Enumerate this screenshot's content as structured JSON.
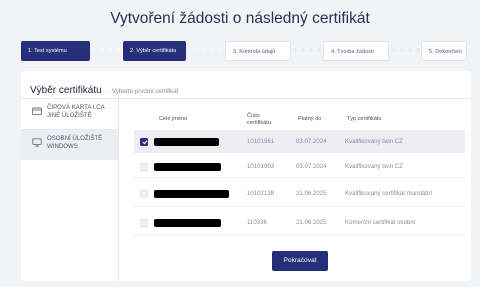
{
  "page": {
    "title": "Vytvoření žádosti o následný certifikát"
  },
  "stepper": {
    "steps": [
      {
        "label": "1. Test systému",
        "state": "done"
      },
      {
        "label": "2. Výběr certifikátu",
        "state": "active"
      },
      {
        "label": "3. Kontrola údajů",
        "state": "pending"
      },
      {
        "label": "4. Tvorba žádosti",
        "state": "pending"
      },
      {
        "label": "5. Dokončení",
        "state": "pending"
      }
    ],
    "separator": "> > > >"
  },
  "card": {
    "title": "Výběr certifikátu",
    "subtitle": "- Vyberte prvotní certifikát"
  },
  "sidebar": {
    "items": [
      {
        "label": "ČIPOVÁ KARTA I.CA JINÉ ÚLOŽIŠTĚ",
        "icon": "card-icon",
        "active": false
      },
      {
        "label": "OSOBNÍ ÚLOŽIŠTĚ WINDOWS",
        "icon": "monitor-icon",
        "active": true
      }
    ]
  },
  "table": {
    "columns": [
      "Celé jméno",
      "Číslo certifikátu",
      "Platný do",
      "Typ certifikátu"
    ],
    "rows": [
      {
        "checked": true,
        "name": "[redacted]",
        "number": "10101961",
        "valid_to": "03.07.2024",
        "type": "Kvalifikovaný twin CZ"
      },
      {
        "checked": false,
        "name": "[redacted]",
        "number": "10101963",
        "valid_to": "03.07.2024",
        "type": "Kvalifikovaný twin CZ"
      },
      {
        "checked": false,
        "name": "[redacted]",
        "number": "10102138",
        "valid_to": "21.06.2025",
        "type": "Kvalifikovaný certifikát mandátní"
      },
      {
        "checked": false,
        "name": "[redacted]",
        "number": "110336",
        "valid_to": "21.06.2025",
        "type": "Komerční certifikát osobní"
      }
    ]
  },
  "actions": {
    "continue_label": "Pokračovat"
  },
  "colors": {
    "primary": "#26307a",
    "selected_row": "#eceef4",
    "background": "#f2f3f6"
  }
}
